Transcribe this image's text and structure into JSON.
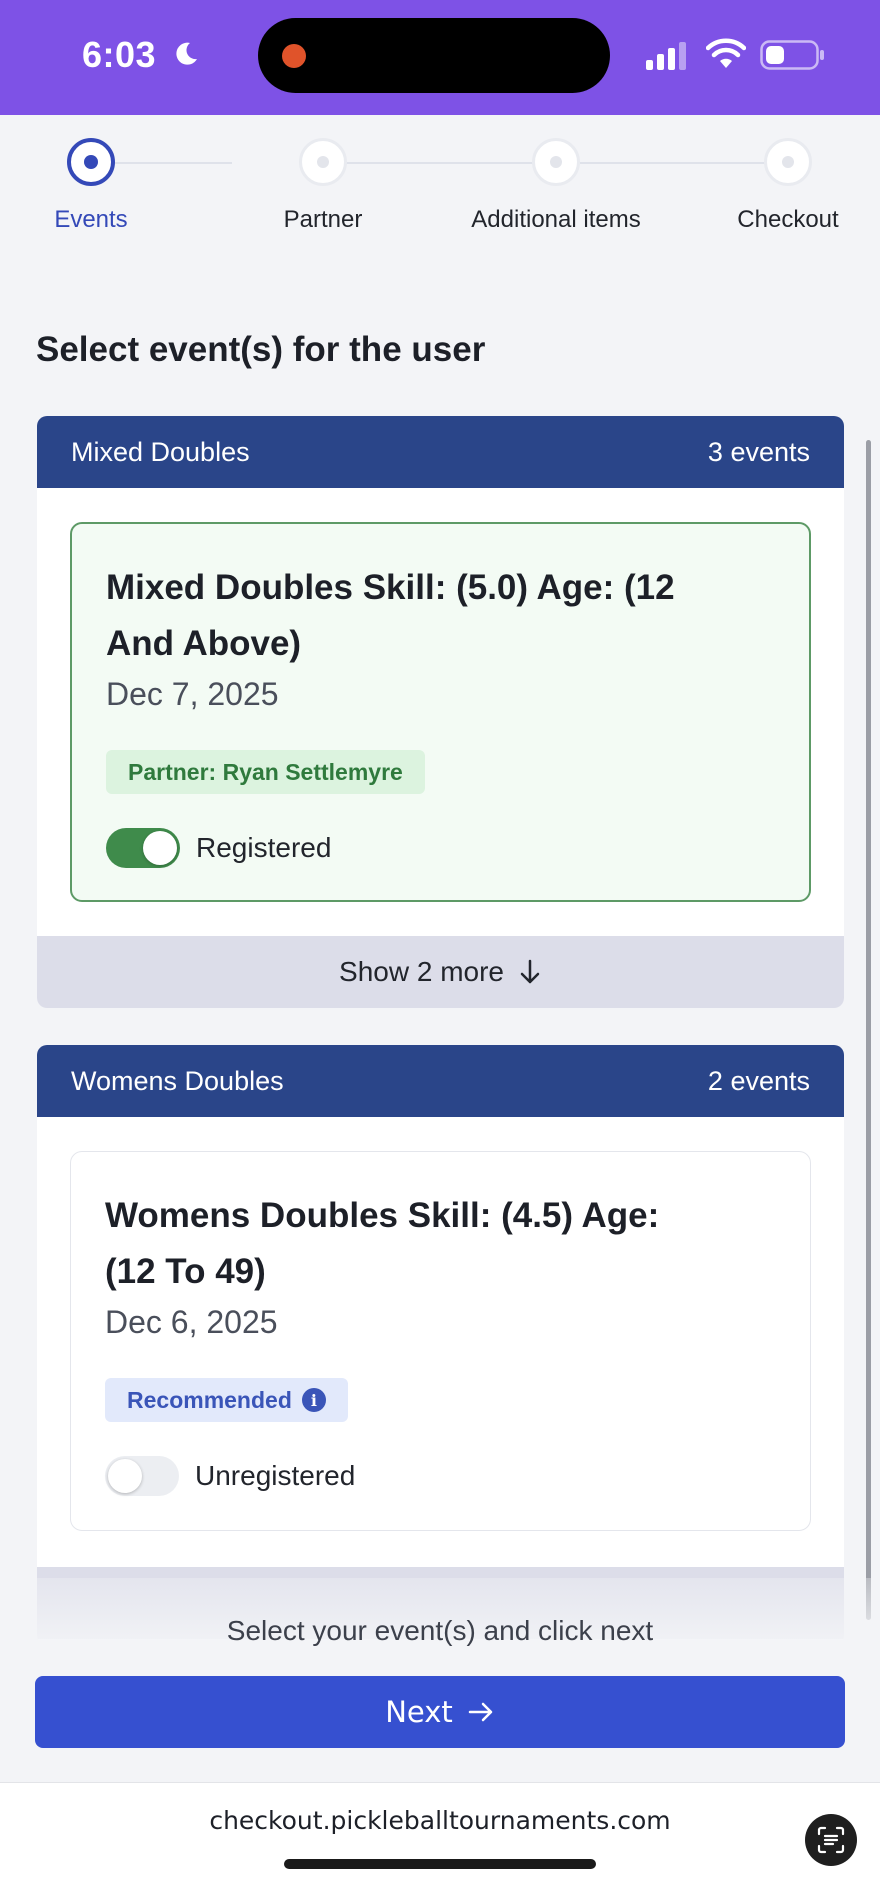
{
  "status_bar": {
    "time": "6:03",
    "icons": [
      "moon-icon",
      "recording-dot-icon",
      "signal-icon",
      "wifi-icon",
      "battery-icon"
    ]
  },
  "stepper": {
    "steps": [
      {
        "label": "Events",
        "active": true
      },
      {
        "label": "Partner",
        "active": false
      },
      {
        "label": "Additional items",
        "active": false
      },
      {
        "label": "Checkout",
        "active": false
      }
    ]
  },
  "heading": "Select event(s) for the user",
  "categories": [
    {
      "name": "Mixed Doubles",
      "count": "3 events",
      "event": {
        "title": "Mixed Doubles Skill: (5.0) Age: (12 And Above)",
        "date": "Dec 7, 2025",
        "badge": "Partner: Ryan Settlemyre",
        "toggle_on": true,
        "status": "Registered"
      },
      "show_more": "Show 2 more"
    },
    {
      "name": "Womens Doubles",
      "count": "2 events",
      "event": {
        "title": "Womens Doubles Skill: (4.5) Age: (12 To 49)",
        "date": "Dec 6, 2025",
        "badge": "Recommended",
        "toggle_on": false,
        "status": "Unregistered"
      }
    }
  ],
  "footer": {
    "hint": "Select your event(s) and click next",
    "next_label": "Next"
  },
  "browser": {
    "url": "checkout.pickleballtournaments.com"
  },
  "colors": {
    "accent": "#3650d0",
    "header_bg": "#2a4589",
    "status_bar": "#7e52e6",
    "registered_green": "#3f8b4b"
  }
}
